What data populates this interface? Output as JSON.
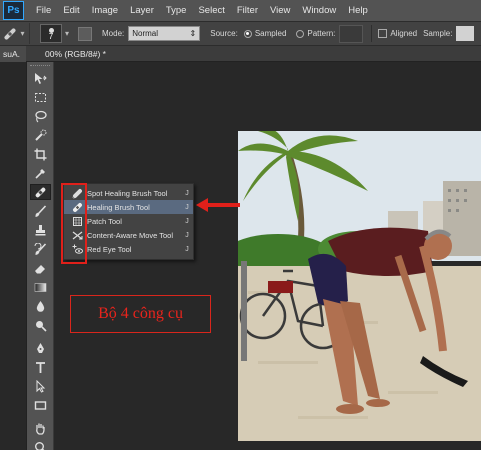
{
  "menubar": {
    "logo": "Ps",
    "items": [
      "File",
      "Edit",
      "Image",
      "Layer",
      "Type",
      "Select",
      "Filter",
      "View",
      "Window",
      "Help"
    ]
  },
  "options": {
    "brush_size": "7",
    "mode_label": "Mode:",
    "mode_value": "Normal",
    "source_label": "Source:",
    "sampled_label": "Sampled",
    "pattern_label": "Pattern:",
    "aligned_label": "Aligned",
    "sample_label": "Sample:"
  },
  "tabs": {
    "left": "suA.",
    "right": "00% (RGB/8#) *"
  },
  "tools": [
    "move-tool",
    "marquee-tool",
    "lasso-tool",
    "quick-selection-tool",
    "crop-tool",
    "eyedropper-tool",
    "healing-tool",
    "brush-tool",
    "clone-stamp-tool",
    "history-brush-tool",
    "eraser-tool",
    "gradient-tool",
    "blur-tool",
    "dodge-tool",
    "pen-tool",
    "type-tool",
    "path-selection-tool",
    "rectangle-tool",
    "hand-tool",
    "zoom-tool"
  ],
  "flyout": [
    {
      "label": "Spot Healing Brush Tool",
      "key": "J",
      "icon": "spot-healing-brush-icon"
    },
    {
      "label": "Healing Brush Tool",
      "key": "J",
      "icon": "healing-brush-icon"
    },
    {
      "label": "Patch Tool",
      "key": "J",
      "icon": "patch-icon"
    },
    {
      "label": "Content-Aware Move Tool",
      "key": "J",
      "icon": "content-aware-move-icon"
    },
    {
      "label": "Red Eye Tool",
      "key": "J",
      "icon": "red-eye-icon"
    }
  ],
  "caption": "Bộ 4 công cụ",
  "colors": {
    "annotation_red": "#e0201a",
    "selected_item": "#5a6a80",
    "logo_blue": "#31a8ff"
  }
}
